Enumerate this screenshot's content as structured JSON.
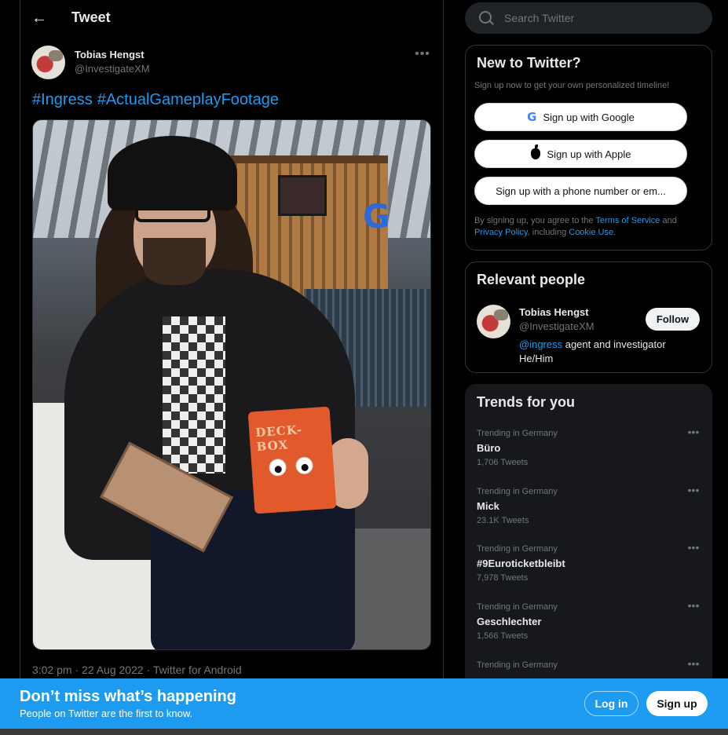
{
  "header": {
    "title": "Tweet"
  },
  "tweet": {
    "author_name": "Tobias Hengst",
    "author_handle": "@InvestigateXM",
    "hashtags": [
      "#Ingress",
      "#ActualGameplayFootage"
    ],
    "photo": {
      "deckbox_text": "DECK-BOX",
      "sign_letter": "G"
    },
    "timestamp": "3:02 pm · 22 Aug 2022 · Twitter for Android"
  },
  "search": {
    "placeholder": "Search Twitter"
  },
  "new_to_twitter": {
    "title": "New to Twitter?",
    "subtitle": "Sign up now to get your own personalized timeline!",
    "google_label": "Sign up with Google",
    "apple_label": "Sign up with Apple",
    "phone_label": "Sign up with a phone number or em...",
    "legal_prefix": "By signing up, you agree to the ",
    "terms_link": "Terms of Service",
    "legal_and": " and ",
    "privacy_link": "Privacy Policy",
    "legal_including": ", including ",
    "cookie_link": "Cookie Use",
    "legal_end": "."
  },
  "relevant": {
    "title": "Relevant people",
    "name": "Tobias Hengst",
    "handle": "@InvestigateXM",
    "follow_label": "Follow",
    "bio_mention": "@ingress",
    "bio_rest": " agent and investigator He/Him"
  },
  "trends": {
    "title": "Trends for you",
    "items": [
      {
        "meta": "Trending in Germany",
        "name": "Büro",
        "count": "1,706 Tweets"
      },
      {
        "meta": "Trending in Germany",
        "name": "Mick",
        "count": "23.1K Tweets"
      },
      {
        "meta": "Trending in Germany",
        "name": "#9Euroticketbleibt",
        "count": "7,978 Tweets"
      },
      {
        "meta": "Trending in Germany",
        "name": "Geschlechter",
        "count": "1,566 Tweets"
      },
      {
        "meta": "Trending in Germany",
        "name": "",
        "count": ""
      }
    ]
  },
  "banner": {
    "title": "Don’t miss what’s happening",
    "subtitle": "People on Twitter are the first to know.",
    "login_label": "Log in",
    "signup_label": "Sign up"
  },
  "colors": {
    "accent": "#1d9bf0",
    "background": "#000000",
    "card": "#16181c",
    "muted": "#71767b"
  },
  "icons": [
    "back-arrow-icon",
    "more-icon",
    "search-icon",
    "google-icon",
    "apple-icon"
  ]
}
